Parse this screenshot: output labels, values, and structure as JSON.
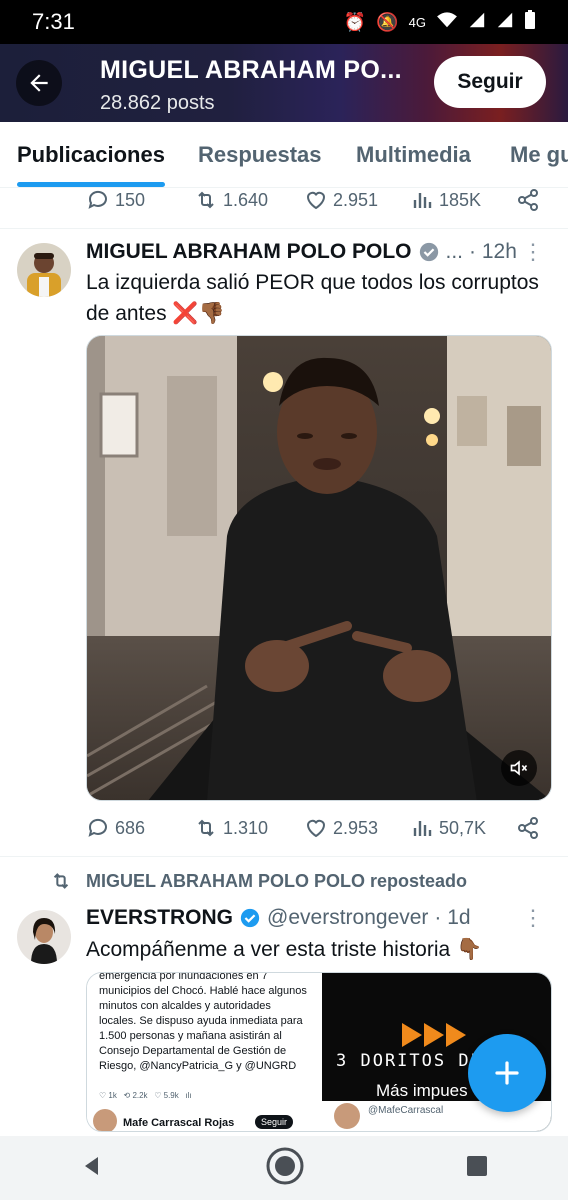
{
  "status_bar": {
    "time": "7:31",
    "network": "4G"
  },
  "header": {
    "name": "MIGUEL ABRAHAM PO...",
    "posts": "28.862 posts",
    "follow_label": "Seguir"
  },
  "tabs": [
    "Publicaciones",
    "Respuestas",
    "Multimedia",
    "Me gu"
  ],
  "prev_post_actions": {
    "replies": "150",
    "reposts": "1.640",
    "likes": "2.951",
    "views": "185K"
  },
  "post1": {
    "name": "MIGUEL ABRAHAM POLO POLO",
    "ellipsis": "...",
    "time": "· 12h",
    "text": "La izquierda salió PEOR que todos los corruptos de antes ❌👎🏾",
    "actions": {
      "replies": "686",
      "reposts": "1.310",
      "likes": "2.953",
      "views": "50,7K"
    }
  },
  "post2": {
    "repost_label": "MIGUEL ABRAHAM POLO POLO reposteado",
    "name": "EVERSTRONG",
    "handle": "@everstrongever",
    "time": "· 1d",
    "text": "Acompáñenme a ver esta triste historia 👇🏾",
    "embedded_left": {
      "text": "emergencia por inundaciones en 7 municipios del Chocó. Hablé hace algunos minutos con alcaldes y autoridades locales. Se dispuso ayuda inmediata para 1.500 personas y mañana asistirán al Consejo Departamental de Gestión de Riesgo, @NancyPatricia_G y @UNGRD",
      "quoted_name": "Mafe Carrascal Rojas",
      "quoted_follow": "Seguir"
    },
    "embedded_right": {
      "title": "3 DORITOS DE",
      "subtitle": "Más impues",
      "handle": "@MafeCarrascal"
    }
  },
  "colors": {
    "accent": "#1d9bf0",
    "verified": "#1d9bf0",
    "text_secondary": "#536471"
  }
}
